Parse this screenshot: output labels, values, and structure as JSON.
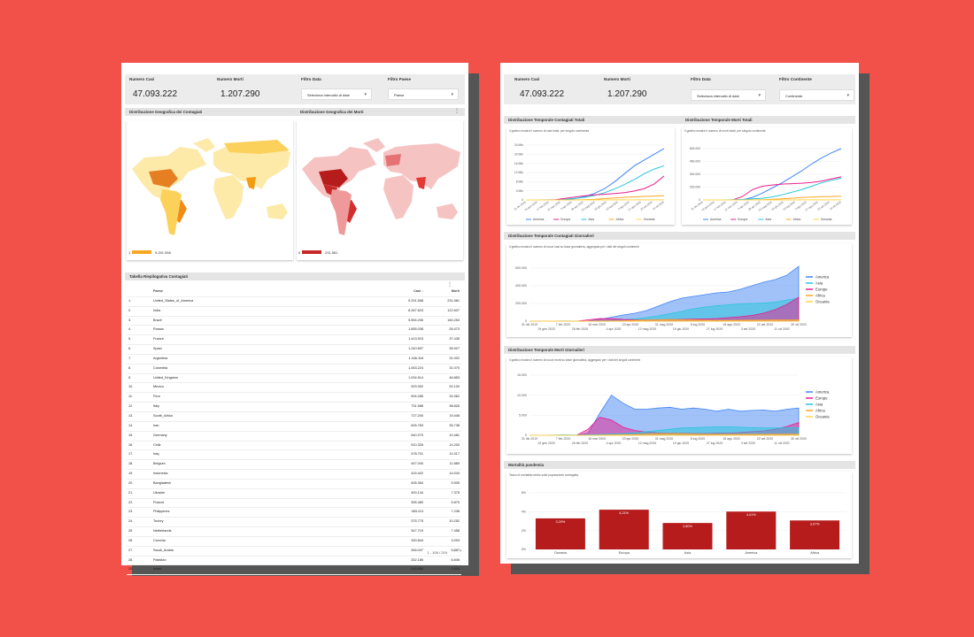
{
  "left_report": {
    "kpi_cases_label": "Numero Casi",
    "kpi_cases_value": "47.093.222",
    "kpi_deaths_label": "Numero Morti",
    "kpi_deaths_value": "1.207.290",
    "filter_date_label": "Filtro Data",
    "filter_date_value": "Seleziona intervallo di date",
    "filter_country_label": "Filtro Paese",
    "filter_country_value": "Paese",
    "map_cases_title": "Distribuzione Geografica dei Contagiati",
    "map_deaths_title": "Distribuzione Geografica dei Morti",
    "map_cases_legend_min": "1",
    "map_cases_legend_max": "9.291.558",
    "map_deaths_legend_min": "0",
    "map_deaths_legend_max": "231.581",
    "table_title": "Tabella Riepilogativa Contagiati",
    "table_headers": {
      "country": "Paese",
      "cases": "Casi ↓",
      "deaths": "Morti"
    },
    "table_pagination": "1 - 100 / 219",
    "table_rows": [
      {
        "n": "1.",
        "country": "United_States_of_America",
        "cases": "9.291.558",
        "deaths": "231.581"
      },
      {
        "n": "2.",
        "country": "India",
        "cases": "8.267.623",
        "deaths": "122.607"
      },
      {
        "n": "3.",
        "country": "Brazil",
        "cases": "5.554.206",
        "deaths": "160.253"
      },
      {
        "n": "4.",
        "country": "Russia",
        "cases": "1.655.038",
        "deaths": "28.473"
      },
      {
        "n": "5.",
        "country": "France",
        "cases": "1.413.915",
        "deaths": "37.435"
      },
      {
        "n": "6.",
        "country": "Spain",
        "cases": "1.240.697",
        "deaths": "35.927"
      },
      {
        "n": "7.",
        "country": "Argentina",
        "cases": "1.166.118",
        "deaths": "31.002"
      },
      {
        "n": "8.",
        "country": "Colombia",
        "cases": "1.063.224",
        "deaths": "31.070"
      },
      {
        "n": "9.",
        "country": "United_Kingdom",
        "cases": "1.034.914",
        "deaths": "46.853"
      },
      {
        "n": "10.",
        "country": "Mexico",
        "cases": "929.392",
        "deaths": "92.100"
      },
      {
        "n": "11.",
        "country": "Peru",
        "cases": "904.285",
        "deaths": "34.362"
      },
      {
        "n": "12.",
        "country": "Italy",
        "cases": "731.588",
        "deaths": "38.826"
      },
      {
        "n": "13.",
        "country": "South_Africa",
        "cases": "727.200",
        "deaths": "19.408"
      },
      {
        "n": "14.",
        "country": "Iran",
        "cases": "626.783",
        "deaths": "35.738"
      },
      {
        "n": "15.",
        "country": "Germany",
        "cases": "540.270",
        "deaths": "10.481"
      },
      {
        "n": "16.",
        "country": "Chile",
        "cases": "510.326",
        "deaths": "14.200"
      },
      {
        "n": "17.",
        "country": "Iraq",
        "cases": "478.701",
        "deaths": "11.017"
      },
      {
        "n": "18.",
        "country": "Belgium",
        "cases": "447.000",
        "deaths": "11.889"
      },
      {
        "n": "19.",
        "country": "Indonesia",
        "cases": "415.402",
        "deaths": "14.044"
      },
      {
        "n": "20.",
        "country": "Bangladesh",
        "cases": "406.364",
        "deaths": "5.905"
      },
      {
        "n": "21.",
        "country": "Ukraine",
        "cases": "400.144",
        "deaths": "7.375"
      },
      {
        "n": "22.",
        "country": "Poland",
        "cases": "395.480",
        "deaths": "5.875"
      },
      {
        "n": "23.",
        "country": "Philippines",
        "cases": "383.113",
        "deaths": "7.238"
      },
      {
        "n": "24.",
        "country": "Turkey",
        "cases": "375.775",
        "deaths": "10.252"
      },
      {
        "n": "25.",
        "country": "Netherlands",
        "cases": "347.719",
        "deaths": "7.458"
      },
      {
        "n": "26.",
        "country": "Czechia",
        "cases": "330.844",
        "deaths": "3.093"
      },
      {
        "n": "27.",
        "country": "Saudi_Arabia",
        "cases": "346.047",
        "deaths": "5.387"
      },
      {
        "n": "28.",
        "country": "Pakistan",
        "cases": "332.186",
        "deaths": "6.608"
      },
      {
        "n": "29.",
        "country": "Israel",
        "cases": "315.858",
        "deaths": "2.559"
      }
    ]
  },
  "right_report": {
    "kpi_cases_label": "Numero Casi",
    "kpi_cases_value": "47.093.222",
    "kpi_deaths_label": "Numero Morti",
    "kpi_deaths_value": "1.207.290",
    "filter_date_label": "Filtro Data",
    "filter_date_value": "Seleziona intervallo di date",
    "filter_continent_label": "Filtro Continente",
    "filter_continent_value": "Continente",
    "band_totals_cases": "Distribuzione Temporale Contagiati Totali",
    "band_totals_deaths": "Distribuzione Temporale Morti Totali",
    "sub_totals_cases": "Il grafico mostra il numero di casi totali, per singolo continente",
    "sub_totals_deaths": "Il grafico mostra il numero di morti totali, per singolo continente",
    "band_daily_cases": "Distribuzione Temporale Contagiati Giornalieri",
    "sub_daily_cases": "Il grafico mostra il numero di nuovi casi su base giornaliera, aggregato per i dati dei singoli continenti",
    "band_daily_deaths": "Distribuzione Temporale Morti Giornalieri",
    "sub_daily_deaths": "Il grafico mostra il numero di nuovi morti su base giornaliera, aggregato per i dati dei singoli continenti",
    "band_mortality": "Mortalità pandemia",
    "sub_mortality": "Tasso di mortalità medio sulla popolazione contagiata"
  },
  "colors": {
    "America": "#4285f4",
    "Europe": "#e91e8c",
    "Asia": "#26c6da",
    "Africa": "#ffa726",
    "Oceania": "#ffd54f",
    "bar": "#b71c1c",
    "map_cases": "#f9a825",
    "map_deaths": "#c62828"
  },
  "chart_data": [
    {
      "type": "line",
      "id": "total_cases",
      "title": "Distribuzione Temporale Contagiati Totali",
      "yticks": [
        "0",
        "4 Mln",
        "8 Mln",
        "12 Mln",
        "16 Mln",
        "20 Mln",
        "24 Mln"
      ],
      "ylim": [
        0,
        24000000
      ],
      "xticks": [
        "31 dic 2019",
        "24 gen 2020",
        "17 feb 2020",
        "12 mar 2020",
        "5 apr 2020",
        "29 apr 2020",
        "23 mag 2020",
        "16 giu 2020",
        "10 lug 2020",
        "3 ago 2020",
        "27 ago 2020",
        "20 set 2020",
        "14 ott 2020"
      ],
      "legend": [
        "America",
        "Europa",
        "Asia",
        "Africa",
        "Oceania"
      ],
      "series": [
        {
          "name": "America",
          "color": "#4285f4",
          "values": [
            0,
            0,
            0,
            0,
            100000,
            600000,
            1500000,
            3000000,
            5000000,
            8000000,
            11500000,
            15000000,
            17500000,
            20000000,
            22500000
          ]
        },
        {
          "name": "Asia",
          "color": "#26c6da",
          "values": [
            0,
            0,
            50000,
            100000,
            300000,
            700000,
            1200000,
            2000000,
            3200000,
            4800000,
            6800000,
            9000000,
            11500000,
            13500000,
            15000000
          ]
        },
        {
          "name": "Europa",
          "color": "#e91e8c",
          "values": [
            0,
            0,
            0,
            100000,
            700000,
            1300000,
            1800000,
            2200000,
            2500000,
            2800000,
            3200000,
            3900000,
            5000000,
            7000000,
            10500000
          ]
        },
        {
          "name": "Africa",
          "color": "#ffa726",
          "values": [
            0,
            0,
            0,
            0,
            10000,
            50000,
            150000,
            300000,
            600000,
            900000,
            1150000,
            1350000,
            1550000,
            1700000,
            1850000
          ]
        },
        {
          "name": "Oceania",
          "color": "#ffd54f",
          "values": [
            0,
            0,
            0,
            0,
            5000,
            7000,
            8000,
            9000,
            12000,
            20000,
            26000,
            30000,
            32000,
            33000,
            34000
          ]
        }
      ]
    },
    {
      "type": "line",
      "id": "total_deaths",
      "title": "Distribuzione Temporale Morti Totali",
      "yticks": [
        "0",
        "150.000",
        "300.000",
        "450.000",
        "600.000"
      ],
      "ylim": [
        0,
        600000
      ],
      "xticks": [
        "31 dic 2019",
        "24 gen 2020",
        "17 feb 2020",
        "12 mar 2020",
        "5 apr 2020",
        "29 apr 2020",
        "23 mag 2020",
        "16 giu 2020",
        "10 lug 2020",
        "3 ago 2020",
        "27 ago 2020",
        "20 set 2020",
        "14 ott 2020"
      ],
      "legend": [
        "America",
        "Europa",
        "Asia",
        "Africa",
        "Oceania"
      ],
      "series": [
        {
          "name": "America",
          "color": "#4285f4",
          "values": [
            0,
            0,
            0,
            0,
            2000,
            30000,
            80000,
            140000,
            200000,
            270000,
            340000,
            420000,
            490000,
            550000,
            600000
          ]
        },
        {
          "name": "Europa",
          "color": "#e91e8c",
          "values": [
            0,
            0,
            0,
            500,
            40000,
            120000,
            160000,
            175000,
            185000,
            190000,
            195000,
            205000,
            220000,
            245000,
            270000
          ]
        },
        {
          "name": "Asia",
          "color": "#26c6da",
          "values": [
            0,
            0,
            500,
            3000,
            6000,
            12000,
            20000,
            35000,
            60000,
            90000,
            120000,
            160000,
            200000,
            230000,
            255000
          ]
        },
        {
          "name": "Africa",
          "color": "#ffa726",
          "values": [
            0,
            0,
            0,
            0,
            100,
            1000,
            3000,
            7000,
            13000,
            20000,
            28000,
            33000,
            37000,
            40000,
            43000
          ]
        },
        {
          "name": "Oceania",
          "color": "#ffd54f",
          "values": [
            0,
            0,
            0,
            0,
            50,
            100,
            110,
            110,
            120,
            300,
            600,
            900,
            930,
            940,
            950
          ]
        }
      ]
    },
    {
      "type": "area",
      "id": "daily_cases",
      "title": "Distribuzione Temporale Contagiati Giornalieri",
      "yticks": [
        "0",
        "200.000",
        "400.000",
        "600.000"
      ],
      "ylim": [
        0,
        600000
      ],
      "xticks_top": [
        "31 dic 2019",
        "7 feb 2020",
        "16 mar 2020",
        "23 apr 2020",
        "31 mag 2020",
        "8 lug 2020",
        "15 ago 2020",
        "22 set 2020",
        "30 ott 2020"
      ],
      "xticks_bottom": [
        "19 gen 2020",
        "26 feb 2020",
        "4 apr 2020",
        "12 mag 2020",
        "19 giu 2020",
        "27 lug 2020",
        "3 set 2020",
        "11 ott 2020"
      ],
      "legend": [
        "America",
        "Asia",
        "Europe",
        "Africa",
        "Oceania"
      ],
      "series": [
        {
          "name": "America",
          "color": "#4285f4",
          "values": [
            0,
            0,
            0,
            0,
            0,
            2000,
            20000,
            45000,
            70000,
            90000,
            120000,
            170000,
            220000,
            260000,
            280000,
            300000,
            320000,
            330000,
            360000,
            400000,
            440000,
            470000,
            520000,
            620000
          ]
        },
        {
          "name": "Asia",
          "color": "#26c6da",
          "values": [
            0,
            0,
            1000,
            2000,
            1000,
            1000,
            5000,
            10000,
            15000,
            25000,
            40000,
            60000,
            85000,
            110000,
            140000,
            160000,
            175000,
            185000,
            195000,
            200000,
            205000,
            215000,
            240000,
            260000
          ]
        },
        {
          "name": "Europe",
          "color": "#e91e8c",
          "values": [
            0,
            0,
            0,
            0,
            0,
            15000,
            30000,
            28000,
            20000,
            15000,
            14000,
            15000,
            18000,
            20000,
            22000,
            25000,
            30000,
            40000,
            50000,
            65000,
            90000,
            130000,
            190000,
            270000
          ]
        },
        {
          "name": "Africa",
          "color": "#ffa726",
          "values": [
            0,
            0,
            0,
            0,
            0,
            0,
            1000,
            2000,
            4000,
            8000,
            12000,
            16000,
            18000,
            16000,
            13000,
            10000,
            9000,
            9000,
            10000,
            11000,
            12000,
            13000,
            14000,
            15000
          ]
        },
        {
          "name": "Oceania",
          "color": "#ffd54f",
          "values": [
            0,
            0,
            0,
            0,
            0,
            200,
            400,
            100,
            50,
            50,
            100,
            300,
            500,
            400,
            200,
            100,
            50,
            50,
            50,
            50,
            50,
            50,
            50,
            50
          ]
        }
      ]
    },
    {
      "type": "area",
      "id": "daily_deaths",
      "title": "Distribuzione Temporale Morti Giornalieri",
      "yticks": [
        "0",
        "5.000",
        "10.000",
        "15.000"
      ],
      "ylim": [
        0,
        15000
      ],
      "xticks_top": [
        "31 dic 2019",
        "7 feb 2020",
        "16 mar 2020",
        "23 apr 2020",
        "31 mag 2020",
        "8 lug 2020",
        "15 ago 2020",
        "22 set 2020",
        "30 ott 2020"
      ],
      "xticks_bottom": [
        "19 gen 2020",
        "26 feb 2020",
        "4 apr 2020",
        "12 mag 2020",
        "19 giu 2020",
        "27 lug 2020",
        "3 set 2020",
        "11 ott 2020"
      ],
      "legend": [
        "America",
        "Europe",
        "Asia",
        "Africa",
        "Oceania"
      ],
      "series": [
        {
          "name": "America",
          "color": "#4285f4",
          "values": [
            0,
            0,
            0,
            0,
            0,
            500,
            5500,
            10000,
            8000,
            6500,
            6500,
            6800,
            7000,
            6500,
            6800,
            6500,
            6000,
            6500,
            6000,
            6200,
            6300,
            6000,
            6500,
            6800
          ]
        },
        {
          "name": "Europe",
          "color": "#e91e8c",
          "values": [
            0,
            0,
            0,
            0,
            0,
            1500,
            4500,
            3800,
            2000,
            1200,
            800,
            600,
            500,
            500,
            450,
            450,
            500,
            550,
            700,
            900,
            1100,
            1500,
            2200,
            3200
          ]
        },
        {
          "name": "Asia",
          "color": "#26c6da",
          "values": [
            0,
            0,
            50,
            100,
            50,
            100,
            200,
            300,
            400,
            600,
            900,
            1200,
            1500,
            1800,
            1900,
            2000,
            2100,
            2100,
            2000,
            1900,
            1800,
            1800,
            1900,
            1900
          ]
        },
        {
          "name": "Africa",
          "color": "#ffa726",
          "values": [
            0,
            0,
            0,
            0,
            0,
            0,
            50,
            100,
            150,
            200,
            300,
            400,
            450,
            400,
            300,
            250,
            230,
            220,
            230,
            240,
            250,
            260,
            270,
            280
          ]
        },
        {
          "name": "Oceania",
          "color": "#ffd54f",
          "values": [
            0,
            0,
            0,
            0,
            0,
            5,
            10,
            5,
            2,
            2,
            5,
            10,
            15,
            10,
            5,
            2,
            2,
            2,
            2,
            2,
            2,
            2,
            2,
            2
          ]
        }
      ]
    },
    {
      "type": "bar",
      "id": "mortality",
      "title": "Mortalità pandemia",
      "yticks": [
        "0%",
        "2%",
        "4%",
        "6%"
      ],
      "ylim": [
        0,
        6
      ],
      "categories": [
        "Oceania",
        "Europa",
        "Asia",
        "America",
        "Africa"
      ],
      "values": [
        3.29,
        4.21,
        2.8,
        4.01,
        3.07
      ],
      "value_labels": [
        "3,29%",
        "4,21%",
        "2,80%",
        "4,01%",
        "3,07%"
      ]
    }
  ]
}
